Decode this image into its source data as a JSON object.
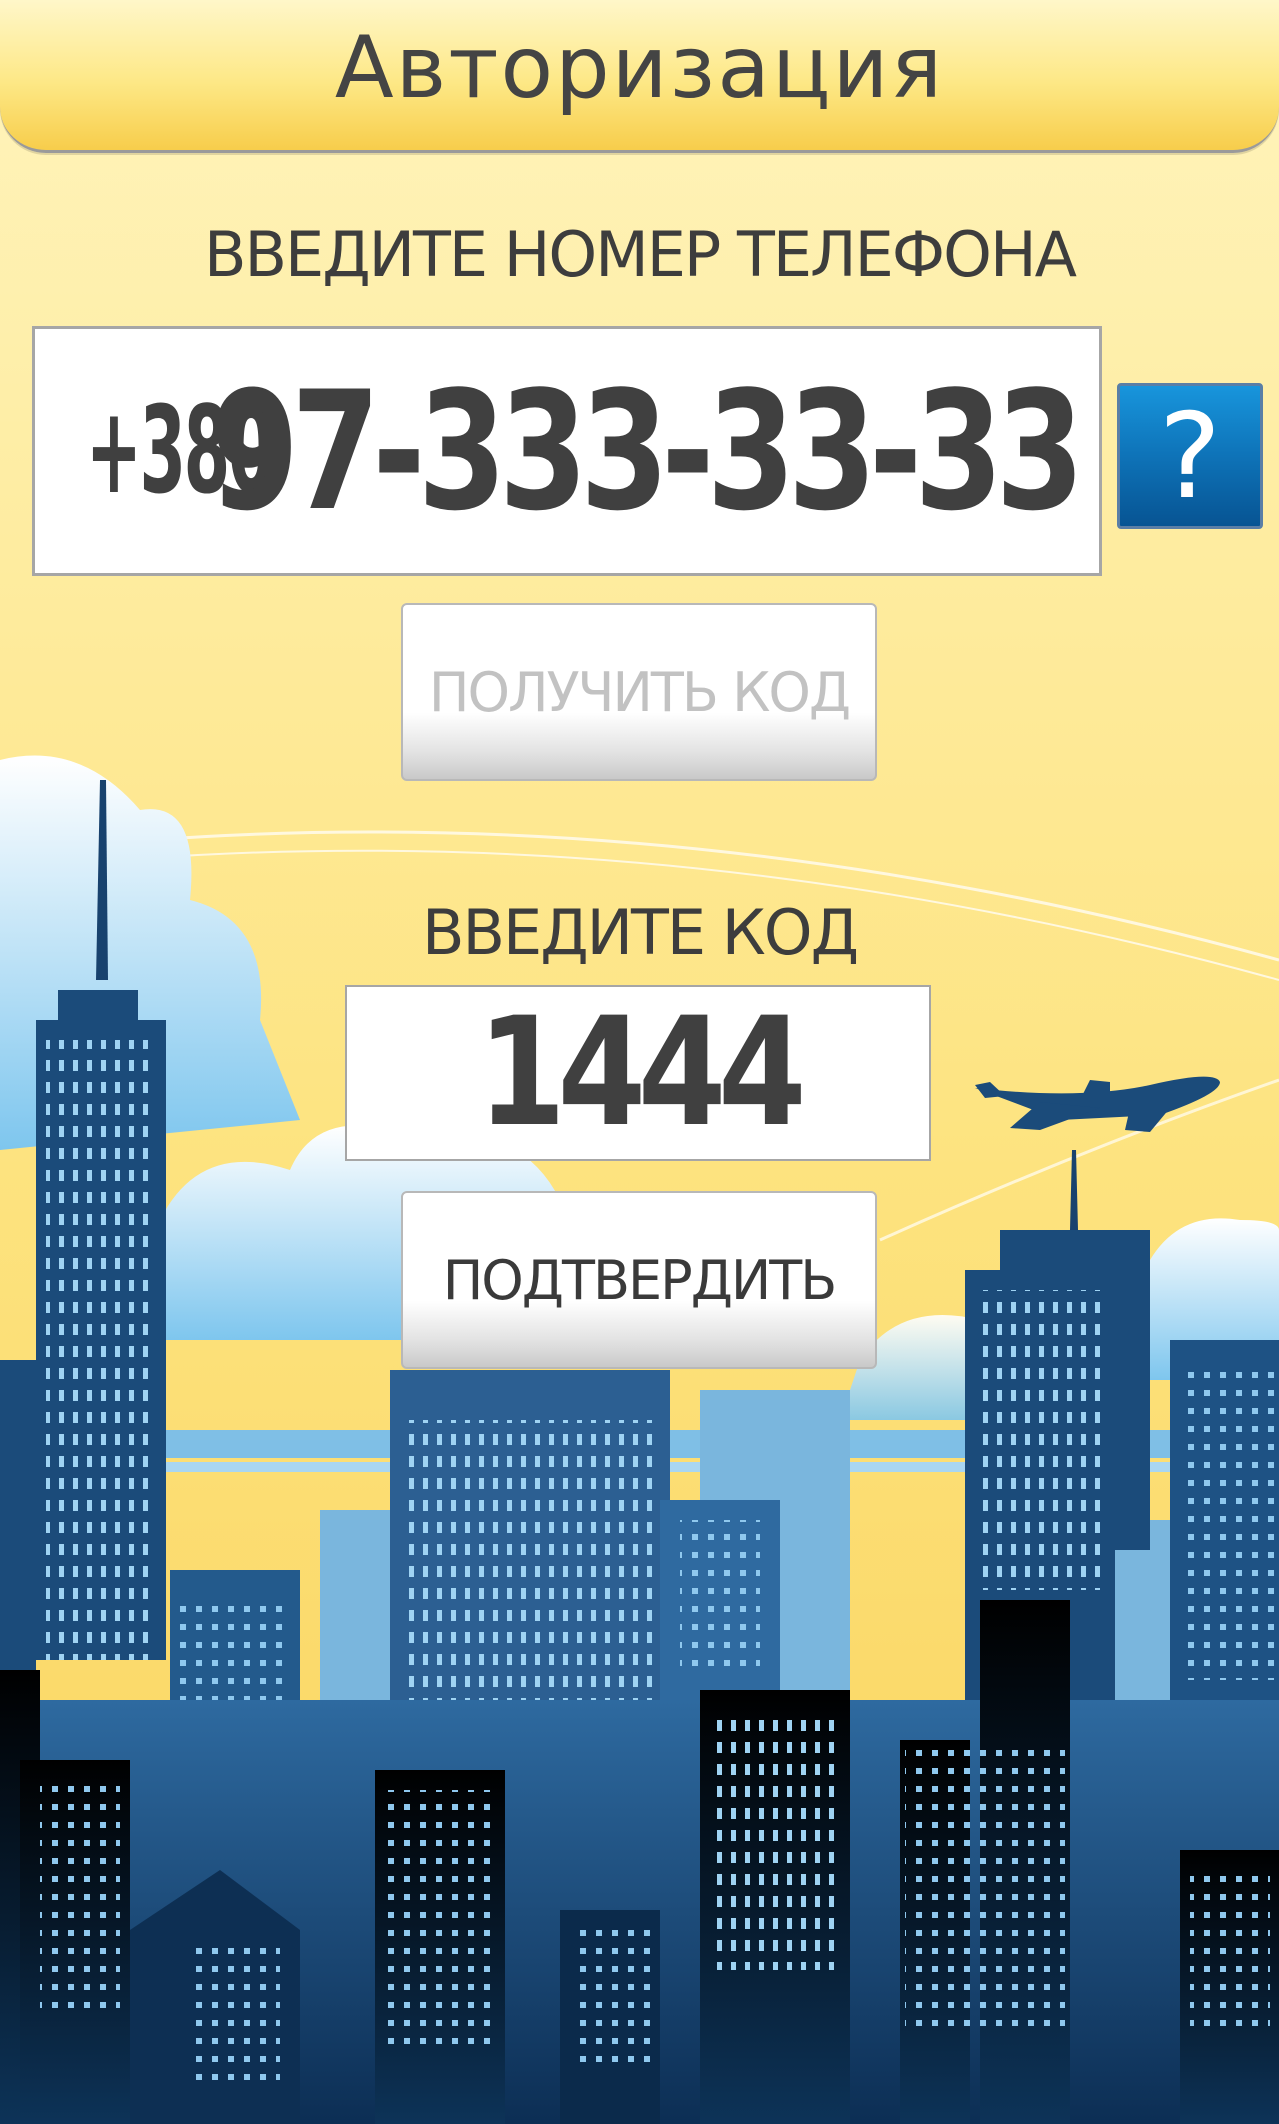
{
  "header": {
    "title": "Авторизация"
  },
  "phone_section": {
    "label": "ВВЕДИТЕ НОМЕР ТЕЛЕФОНА",
    "prefix": "+380",
    "value": "97-333-33-33",
    "help_glyph": "?",
    "help_icon": "question-mark-icon"
  },
  "get_code_button": {
    "label": "ПОЛУЧИТЬ КОД"
  },
  "code_section": {
    "label": "ВВЕДИТЕ КОД",
    "value": "1444"
  },
  "confirm_button": {
    "label": "ПОДТВЕРДИТЬ"
  },
  "colors": {
    "accent_blue": "#0e73b8",
    "header_yellow": "#fde886",
    "text_dark": "#404040",
    "disabled_text": "#c2c2c2"
  }
}
